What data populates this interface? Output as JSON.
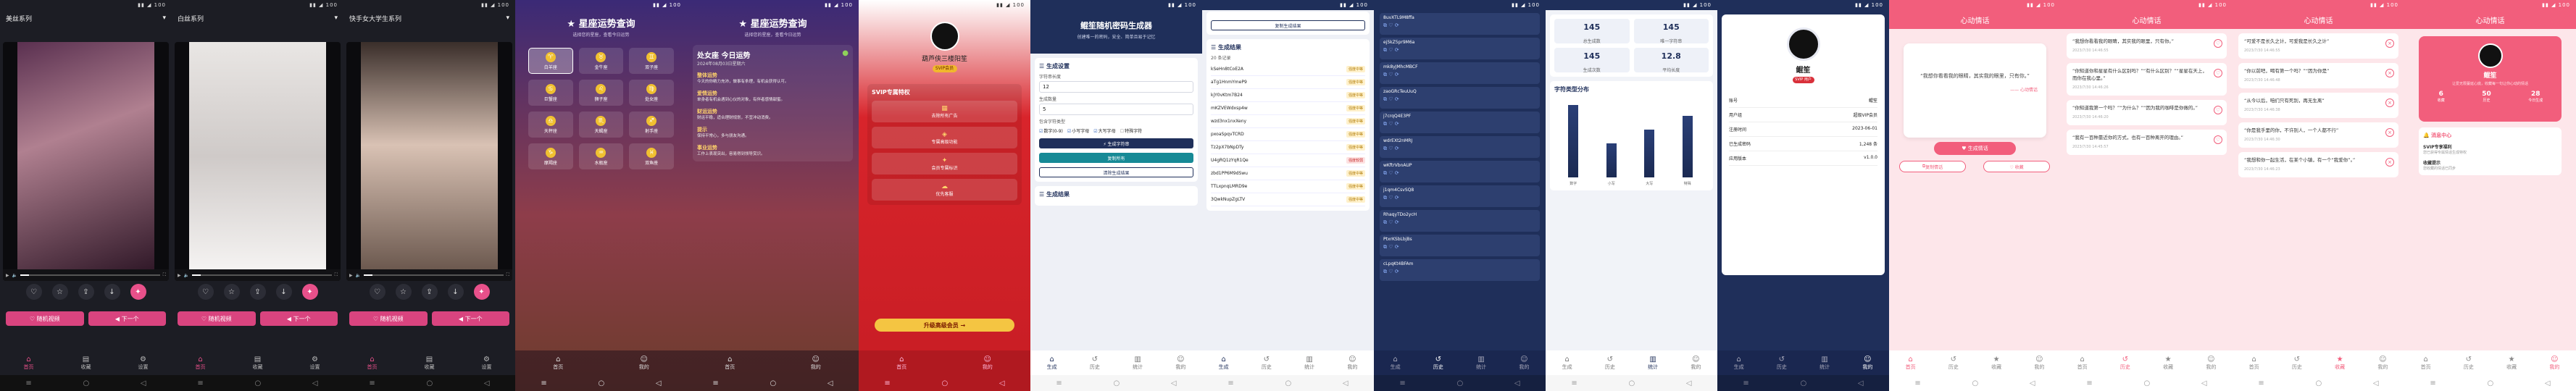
{
  "colors": {
    "video_bg": "#1c1d24",
    "pink": "#d9447f",
    "navy": "#1f2f5a",
    "svip_red": "#c71d24",
    "love_pink": "#f25e7c"
  },
  "video_phones": [
    {
      "time": "",
      "series": "美丝系列",
      "progress": 0.06,
      "btn_a": "♡ 随机视频",
      "btn_b": "◀ 下一个"
    },
    {
      "time": "",
      "series": "白丝系列",
      "progress": 0.06,
      "btn_a": "♡ 随机视频",
      "btn_b": "◀ 下一个"
    },
    {
      "time": "",
      "series": "快手女大学生系列",
      "progress": 0.06,
      "btn_a": "♡ 随机视频",
      "btn_b": "◀ 下一个"
    }
  ],
  "video_tabs": [
    "首页",
    "收藏",
    "设置"
  ],
  "horo": {
    "title": "★ 星座运势查询",
    "sub": "选择您的星座，查看今日运势",
    "signs": [
      "白羊座",
      "金牛座",
      "双子座",
      "巨蟹座",
      "狮子座",
      "处女座",
      "天秤座",
      "天蝎座",
      "射手座",
      "摩羯座",
      "水瓶座",
      "双鱼座"
    ],
    "signs_icons": [
      "♈",
      "♉",
      "♊",
      "♋",
      "♌",
      "♍",
      "♎",
      "♏",
      "♐",
      "♑",
      "♒",
      "♓"
    ],
    "tabs": [
      "首页",
      "我的"
    ]
  },
  "fortune": {
    "title": "处女座 今日运势",
    "date": "2024年08月03日星期六",
    "sections": [
      {
        "h": "整体运势",
        "p": "今天的你精力充沛，做事有条理，有机会获得认可。"
      },
      {
        "h": "爱情运势",
        "p": "单身者有机会遇到心仪的对象，有伴者感情甜蜜。"
      },
      {
        "h": "财运运势",
        "p": "财运平稳，适合理财规划，不宜冲动消费。"
      },
      {
        "h": "提示",
        "p": "保持平常心，多与朋友沟通。"
      },
      {
        "h": "事业运势",
        "p": "工作上表现突出，容易得到领导赏识。"
      }
    ]
  },
  "svip": {
    "name": "葫芦侠三楼阳笙",
    "badge": "SVIP会员",
    "card_title": "SVIP专属特权",
    "features": [
      {
        "icon": "▦",
        "label": "去除所有广告"
      },
      {
        "icon": "◈",
        "label": "专属高级功能"
      },
      {
        "icon": "✦",
        "label": "会员专属标识"
      },
      {
        "icon": "☁",
        "label": "优先客服"
      }
    ],
    "upgrade": "升级高级会员 →"
  },
  "gen": {
    "title": "鲲笙随机密码生成器",
    "subtitle": "创建唯一的密码，安全、简单且易于记忆",
    "settings_title": "生成设置",
    "len_label": "字符串长度",
    "len_val": "12",
    "count_label": "生成数量",
    "count_val": "5",
    "types_label": "包含字符类型",
    "types": [
      {
        "l": "数字(0-9)",
        "on": true
      },
      {
        "l": "小写字母",
        "on": true
      },
      {
        "l": "大写字母",
        "on": true
      },
      {
        "l": "特殊字符",
        "on": false
      }
    ],
    "b_generate": "⚡ 生成字符串",
    "b_copy": "复制所有",
    "b_clear": "清除生成结果",
    "results_title": "生成结果",
    "tabs": [
      "生成",
      "历史",
      "统计",
      "我的"
    ]
  },
  "results": {
    "top_btn": "复制生成结果",
    "title": "生成结果",
    "count": "20 条记录",
    "rows": [
      {
        "s": "kSeHn8tCoE2A",
        "t": "强度中等",
        "k": "m"
      },
      {
        "s": "aTg1HnmYmeP9",
        "t": "强度中等",
        "k": "m"
      },
      {
        "s": "kjY0vKtm7B24",
        "t": "强度中等",
        "k": "m"
      },
      {
        "s": "mKZVEWdxsp4w",
        "t": "强度中等",
        "k": "m"
      },
      {
        "s": "wzd3nx1nxXeny",
        "t": "强度中等",
        "k": "m"
      },
      {
        "s": "pxoaSpqvTCRD",
        "t": "强度中等",
        "k": "m"
      },
      {
        "s": "Tz2pX7bNpDTy",
        "t": "强度中等",
        "k": "m"
      },
      {
        "s": "U4gRQ1zYqR1Qe",
        "t": "强度较弱",
        "k": "w"
      },
      {
        "s": "zbd1PP6M9dSwu",
        "t": "强度中等",
        "k": "m"
      },
      {
        "s": "TTLxpnqLMRD9e",
        "t": "强度中等",
        "k": "m"
      },
      {
        "s": "3QwkNupZgLTV",
        "t": "强度中等",
        "k": "m"
      }
    ]
  },
  "history": {
    "items": [
      "8uvXTL9M8ffa",
      "ej5kZ5pr9M6a",
      "mk8yJMhcMBCF",
      "zaoGRcTeuUuQ",
      "j7crqQ4E3PF",
      "wdrEXt2nMRJ",
      "wKftrVbnAUP",
      "j1qm4CsvSQ8",
      "RhaqyTDo2ycH",
      "PtxrKSbLbjBs",
      "cLpqKt4BFAm"
    ],
    "tabs": [
      "生成",
      "历史",
      "统计",
      "我的"
    ]
  },
  "stats": {
    "cards": [
      {
        "v": "145",
        "l": "总生成数"
      },
      {
        "v": "145",
        "l": "唯一字符串"
      },
      {
        "v": "145",
        "l": "生成次数"
      },
      {
        "v": "12.8",
        "l": "平均长度"
      }
    ],
    "chart_title": "字符类型分布",
    "chart_data": {
      "type": "bar",
      "categories": [
        "数字",
        "小写",
        "大写",
        "特殊"
      ],
      "values": [
        68,
        32,
        45,
        58
      ]
    },
    "tabs": [
      "生成",
      "历史",
      "统计",
      "我的"
    ]
  },
  "profile": {
    "name": "鲲笙",
    "vip": "SVIP 用户",
    "rows": [
      {
        "k": "账号",
        "v": "鲲笙"
      },
      {
        "k": "用户组",
        "v": "超级VIP会员"
      },
      {
        "k": "注册时间",
        "v": "2023-06-01"
      },
      {
        "k": "已生成密码",
        "v": "1,248 条"
      },
      {
        "k": "应用版本",
        "v": "v1.0.0"
      }
    ],
    "tabs": [
      "生成",
      "历史",
      "统计",
      "我的"
    ]
  },
  "love": {
    "header": "心动情话",
    "quote": "“我想你看看我的眼睛，其实我的眼里，只有你。”",
    "by": "—— 心动情话",
    "heart_btn": "♥ 生成情话",
    "copy_btn": "复制情话",
    "save_btn": "♡ 收藏",
    "tabs": [
      "首页",
      "历史",
      "收藏",
      "我的"
    ],
    "list1": [
      {
        "t": "“我想你看看我的眼睛，其实我的眼里，只有你。”",
        "d": "2023/7/30 14:46:55"
      },
      {
        "t": "“你知道你和星星有什么区别吗？”“有什么区别？”“星星在天上，而你在我心里。”",
        "d": "2023/7/30 14:46:26"
      },
      {
        "t": "“你知道我第一个吗？”“为什么？”“因为我的咖啡是你做的。”",
        "d": "2023/7/30 14:46:20"
      },
      {
        "t": "“我有一百种靠近你的方式，也有一百种离开的理由。”",
        "d": "2023/7/30 14:45:57"
      }
    ],
    "list2": [
      {
        "t": "“可爱不是长久之计，可爱我是长久之计”",
        "d": "2023/7/30 14:46:55"
      },
      {
        "t": "“你以前吧，喝有第一个吗？”“因为你是”",
        "d": "2023/7/30 14:46:48"
      },
      {
        "t": "“从今以后，咱们只有死别，再无生离”",
        "d": "2023/7/30 14:46:38"
      },
      {
        "t": "“你是我手里的你，不许别人，一个人都不行”",
        "d": "2023/7/30 14:46:30"
      },
      {
        "t": "“我想和你一起生活，在某个小镇，有一个“我爱你”。”",
        "d": "2023/7/30 14:46:23"
      }
    ],
    "prof": {
      "name": "鲲笙",
      "desc": "让爱无限蔓延心底，收藏每一句让你心动的情话",
      "stats": [
        {
          "v": "6",
          "l": "收藏"
        },
        {
          "v": "50",
          "l": "历史"
        },
        {
          "v": "28",
          "l": "今日生成"
        }
      ],
      "msg_title": "消息中心",
      "msgs": [
        {
          "h": "SVIP专享福利",
          "s": "您已获得专属情话生成特权"
        },
        {
          "h": "收藏提示",
          "s": "您收藏的情话已同步"
        }
      ]
    }
  },
  "statusbar_right": "▮▮ ◢ 100"
}
